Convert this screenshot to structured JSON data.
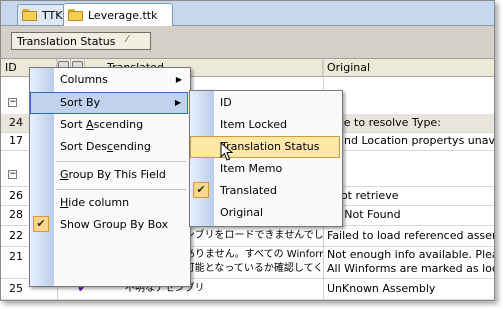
{
  "tabs": [
    {
      "label": "TTK",
      "active": false
    },
    {
      "label": "Leverage.ttk",
      "active": true
    }
  ],
  "group_box": {
    "chip_label": "Translation Status",
    "chip_close": "⁄"
  },
  "columns": {
    "id": "ID",
    "translated": "Translated",
    "original": "Original"
  },
  "rows": [
    {
      "type": "group",
      "label": ""
    },
    {
      "type": "data",
      "id": "24",
      "translated": "",
      "original": "able to resolve Type:",
      "selected": true
    },
    {
      "type": "data",
      "id": "17",
      "translated": "",
      "original": "e and Location propertys unavaila"
    },
    {
      "type": "group",
      "label": ""
    },
    {
      "type": "data",
      "id": "26",
      "translated": "",
      "original": "nnot retrieve"
    },
    {
      "type": "data",
      "id": "28",
      "translated": "",
      "original": "pe Not Found"
    },
    {
      "type": "data",
      "id": "22",
      "checked": true,
      "translated": "参照するアセンブリをロードできませんでした:",
      "original": "Failed to load referenced assembly:"
    },
    {
      "type": "data2",
      "id": "21",
      "checked": true,
      "translated": "十分な情報がありません。すべての Winform が",
      "translated2": "ローカライズ可能となっているか確認してください。",
      "original": "Not enough info available. Please e",
      "original2": "All Winforms are marked as localiza"
    },
    {
      "type": "data",
      "id": "25",
      "checked": true,
      "translated": "不明なアセンブリ",
      "original": "UnKnown Assembly"
    }
  ],
  "context_menu": {
    "items": [
      {
        "label": "Columns",
        "underline": "",
        "submenu": true
      },
      {
        "label": "Sort By",
        "underline": "",
        "submenu": true,
        "highlighted": true
      },
      {
        "label_pre": "Sort ",
        "label_u": "A",
        "label_post": "scending"
      },
      {
        "label_pre": "Sort Des",
        "label_u": "c",
        "label_post": "ending"
      },
      {
        "label_pre": "",
        "label_u": "G",
        "label_post": "roup By This Field"
      },
      {
        "label_pre": "",
        "label_u": "H",
        "label_post": "ide column"
      },
      {
        "label": "Show Group By Box",
        "checked": true
      }
    ]
  },
  "sort_submenu": {
    "items": [
      {
        "label": "ID"
      },
      {
        "label": "Item Locked"
      },
      {
        "label": "Translation Status",
        "highlighted": true
      },
      {
        "label": "Item Memo"
      },
      {
        "label": "Translated",
        "checked": true
      },
      {
        "label": "Original"
      }
    ]
  },
  "colors": {
    "accent_check": "#5b2b8c",
    "menu_highlight": "#ffe7a8",
    "menu_highlight_border": "#d19a3a"
  }
}
